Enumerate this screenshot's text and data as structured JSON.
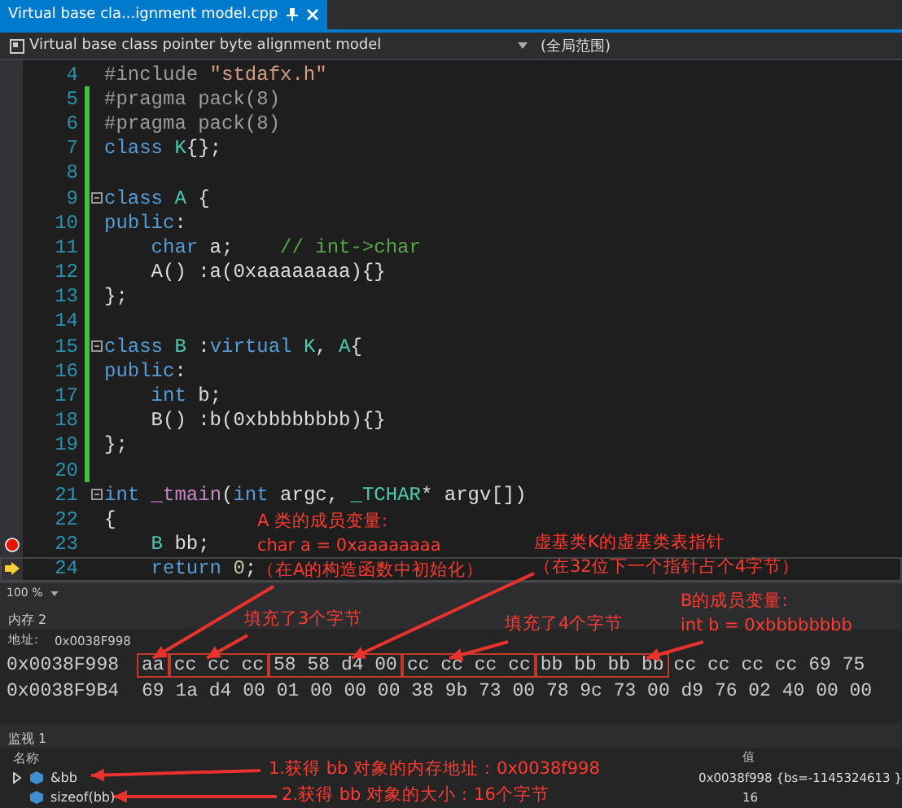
{
  "tab": {
    "title": "Virtual base cla...ignment model.cpp",
    "selected": true
  },
  "navbar": {
    "project": "Virtual base class pointer byte alignment model",
    "scope": "(全局范围)"
  },
  "code_lines": [
    {
      "number": "4",
      "changed": false,
      "fold": false,
      "breakpoint": false,
      "current": false,
      "tokens": [
        {
          "kind": "preproc",
          "text": "#include"
        },
        {
          "kind": "string",
          "text": " \"stdafx.h\""
        }
      ]
    },
    {
      "number": "5",
      "changed": true,
      "fold": false,
      "breakpoint": false,
      "current": false,
      "tokens": [
        {
          "kind": "preproc",
          "text": "#pragma pack(8)"
        }
      ]
    },
    {
      "number": "6",
      "changed": true,
      "fold": false,
      "breakpoint": false,
      "current": false,
      "tokens": [
        {
          "kind": "preproc",
          "text": "#pragma pack(8)"
        }
      ]
    },
    {
      "number": "7",
      "changed": true,
      "fold": false,
      "breakpoint": false,
      "current": false,
      "tokens": [
        {
          "kind": "keyword",
          "text": "class"
        },
        {
          "kind": "type",
          "text": " K"
        },
        {
          "kind": "plain",
          "text": "{};"
        }
      ]
    },
    {
      "number": "8",
      "changed": true,
      "fold": false,
      "breakpoint": false,
      "current": false
    },
    {
      "number": "9",
      "changed": true,
      "fold": true,
      "breakpoint": false,
      "current": false,
      "tokens": [
        {
          "kind": "keyword",
          "text": "class"
        },
        {
          "kind": "type",
          "text": " A"
        },
        {
          "kind": "plain",
          "text": " {"
        }
      ]
    },
    {
      "number": "10",
      "changed": true,
      "fold": false,
      "breakpoint": false,
      "current": false,
      "tokens": [
        {
          "kind": "keyword",
          "text": "public"
        },
        {
          "kind": "plain",
          "text": ":"
        }
      ]
    },
    {
      "number": "11",
      "changed": true,
      "fold": false,
      "breakpoint": false,
      "current": false,
      "tokens": [
        {
          "kind": "keyword",
          "text": "    char"
        },
        {
          "kind": "plain",
          "text": " a;"
        },
        {
          "kind": "comment",
          "text": "    // int->char"
        }
      ]
    },
    {
      "number": "12",
      "changed": true,
      "fold": false,
      "breakpoint": false,
      "current": false,
      "tokens": [
        {
          "kind": "plain",
          "text": "    A() :a(0xaaaaaaaa){}"
        }
      ]
    },
    {
      "number": "13",
      "changed": true,
      "fold": false,
      "breakpoint": false,
      "current": false,
      "tokens": [
        {
          "kind": "plain",
          "text": "};"
        }
      ]
    },
    {
      "number": "14",
      "changed": true,
      "fold": false,
      "breakpoint": false,
      "current": false
    },
    {
      "number": "15",
      "changed": true,
      "fold": true,
      "breakpoint": false,
      "current": false,
      "tokens": [
        {
          "kind": "keyword",
          "text": "class"
        },
        {
          "kind": "type",
          "text": " B"
        },
        {
          "kind": "plain",
          "text": " :"
        },
        {
          "kind": "keyword",
          "text": "virtual"
        },
        {
          "kind": "type",
          "text": " K"
        },
        {
          "kind": "plain",
          "text": ","
        },
        {
          "kind": "type",
          "text": " A"
        },
        {
          "kind": "plain",
          "text": "{"
        }
      ]
    },
    {
      "number": "16",
      "changed": true,
      "fold": false,
      "breakpoint": false,
      "current": false,
      "tokens": [
        {
          "kind": "keyword",
          "text": "public"
        },
        {
          "kind": "plain",
          "text": ":"
        }
      ]
    },
    {
      "number": "17",
      "changed": true,
      "fold": false,
      "breakpoint": false,
      "current": false,
      "tokens": [
        {
          "kind": "keyword",
          "text": "    int"
        },
        {
          "kind": "plain",
          "text": " b;"
        }
      ]
    },
    {
      "number": "18",
      "changed": true,
      "fold": false,
      "breakpoint": false,
      "current": false,
      "tokens": [
        {
          "kind": "plain",
          "text": "    B() :b(0xbbbbbbbb){}"
        }
      ]
    },
    {
      "number": "19",
      "changed": true,
      "fold": false,
      "breakpoint": false,
      "current": false,
      "tokens": [
        {
          "kind": "plain",
          "text": "};"
        }
      ]
    },
    {
      "number": "20",
      "changed": true,
      "fold": false,
      "breakpoint": false,
      "current": false
    },
    {
      "number": "21",
      "changed": false,
      "fold": true,
      "breakpoint": false,
      "current": false,
      "tokens": [
        {
          "kind": "keyword",
          "text": "int"
        },
        {
          "kind": "function",
          "text": " _tmain"
        },
        {
          "kind": "plain",
          "text": "("
        },
        {
          "kind": "keyword",
          "text": "int"
        },
        {
          "kind": "plain",
          "text": " argc,"
        },
        {
          "kind": "type",
          "text": " _TCHAR"
        },
        {
          "kind": "plain",
          "text": "* argv[])"
        }
      ]
    },
    {
      "number": "22",
      "changed": false,
      "fold": false,
      "breakpoint": false,
      "current": false,
      "tokens": [
        {
          "kind": "plain",
          "text": "{"
        }
      ]
    },
    {
      "number": "23",
      "changed": false,
      "fold": false,
      "breakpoint": true,
      "current": false,
      "tokens": [
        {
          "kind": "type",
          "text": "    B"
        },
        {
          "kind": "plain",
          "text": " bb;"
        }
      ]
    },
    {
      "number": "24",
      "changed": false,
      "fold": false,
      "breakpoint": false,
      "current": true,
      "tokens": [
        {
          "kind": "keyword",
          "text": "    return"
        },
        {
          "kind": "number",
          "text": " 0"
        },
        {
          "kind": "plain",
          "text": ";"
        }
      ]
    }
  ],
  "zoom": "100 %",
  "memory": {
    "title": "内存 2",
    "address_label": "地址:",
    "address": "0x0038F998",
    "rows": [
      {
        "address": "0x0038F998",
        "groups": [
          {
            "bytes": "aa",
            "boxed": true
          },
          {
            "bytes": "cc cc cc",
            "boxed": true
          },
          {
            "bytes": "58 58 d4 00",
            "boxed": true
          },
          {
            "bytes": "cc cc cc cc",
            "boxed": true
          },
          {
            "bytes": "bb bb bb bb",
            "boxed": true
          },
          {
            "bytes": "cc cc cc cc 69 75",
            "boxed": false
          }
        ]
      },
      {
        "address": "0x0038F9B4",
        "groups": [
          {
            "bytes": "69 1a d4 00 01 00 00 00 38 9b 73 00 78 9c 73 00 d9 76 02 40 00 00",
            "boxed": false
          }
        ]
      }
    ]
  },
  "watch": {
    "title": "监视 1",
    "columns": [
      "名称",
      "值"
    ],
    "rows": [
      {
        "name": "&bb",
        "value": "0x0038f998 {bs=-1145324613 }",
        "expandable": true
      },
      {
        "name": "sizeof(bb)",
        "value": "16",
        "expandable": false
      }
    ]
  },
  "annotations": [
    {
      "lines": [
        "A 类的成员变量:",
        "char a = 0xaaaaaaaa",
        "（在A的构造函数中初始化）"
      ]
    },
    {
      "lines": [
        "虚基类K的虚基类表指针",
        "（在32位下一个指针占个4字节）"
      ]
    },
    {
      "lines": [
        "填充了3个字节"
      ]
    },
    {
      "lines": [
        "填充了4个字节"
      ]
    },
    {
      "lines": [
        "B的成员变量:",
        "int b = 0xbbbbbbbb"
      ]
    },
    {
      "lines": [
        "1.获得 bb 对象的内存地址：0x0038f998"
      ]
    },
    {
      "lines": [
        "2.获得 bb 对象的大小：16个字节"
      ]
    }
  ]
}
